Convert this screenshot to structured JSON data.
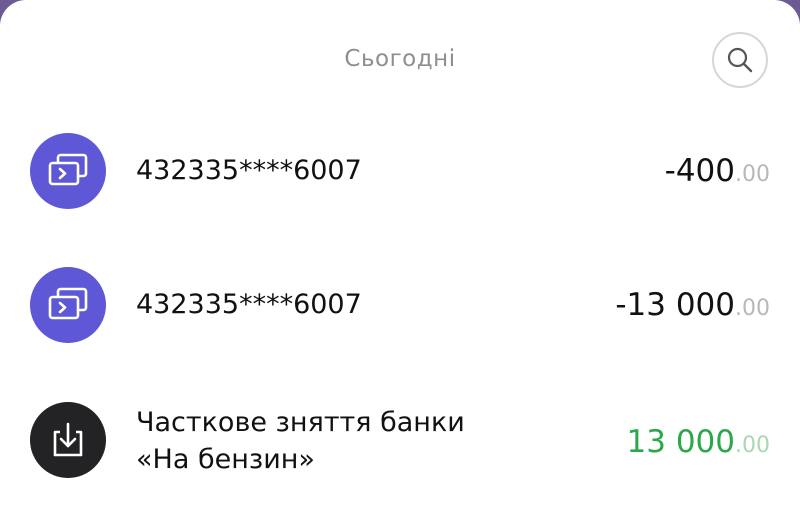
{
  "header": {
    "date_label": "Сьогодні",
    "search_icon": "search-icon"
  },
  "transactions": [
    {
      "icon": "card-transfer-icon",
      "icon_color": "#5e58d6",
      "title_line1": "432335****6007",
      "title_line2": "",
      "amount_main": "-400",
      "amount_cents": ".00",
      "amount_color": "#111111"
    },
    {
      "icon": "card-transfer-icon",
      "icon_color": "#5e58d6",
      "title_line1": "432335****6007",
      "title_line2": "",
      "amount_main": "-13 000",
      "amount_cents": ".00",
      "amount_color": "#111111"
    },
    {
      "icon": "jar-withdraw-icon",
      "icon_color": "#232325",
      "title_line1": "Часткове зняття банки",
      "title_line2": "«На бензин»",
      "amount_main": "13 000",
      "amount_cents": ".00",
      "amount_color": "#2aa84a"
    }
  ]
}
